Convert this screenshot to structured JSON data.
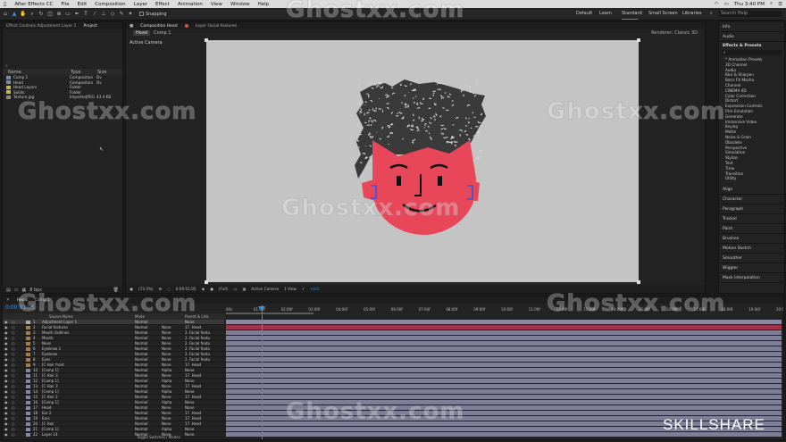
{
  "menubar": {
    "app": "After Effects CC",
    "items": [
      "File",
      "Edit",
      "Composition",
      "Layer",
      "Effect",
      "Animation",
      "View",
      "Window",
      "Help"
    ],
    "clock": "Thu 3:40 PM"
  },
  "toolbar": {
    "snapping": "Snapping",
    "workspaces": [
      "Default",
      "Learn",
      "Standard",
      "Small Screen",
      "Libraries"
    ],
    "search": "Search Help"
  },
  "project": {
    "tab_effect": "Effect Controls Adjustment Layer 1",
    "tab_project": "Project",
    "columns": [
      "Name",
      "Type",
      "Size"
    ],
    "rows": [
      {
        "name": "Comp 1",
        "type": "Composition",
        "size": "Dv"
      },
      {
        "name": "Head",
        "type": "Composition",
        "size": "Dv"
      },
      {
        "name": "Head Layers",
        "type": "Folder",
        "size": ""
      },
      {
        "name": "Solids",
        "type": "Folder",
        "size": ""
      },
      {
        "name": "Texture.jpg",
        "type": "ImporterJPEG",
        "size": "43.4 KB"
      }
    ],
    "bpc": "8 bpc"
  },
  "comp": {
    "tab_comp": "Composition Head",
    "tab_layer": "Layer Facial features",
    "sub_tabs": [
      "Head",
      "Comp 1"
    ],
    "active_camera": "Active Camera",
    "renderer_label": "Renderer:",
    "renderer": "Classic 3D",
    "footer": {
      "zoom": "(73.3%)",
      "time": "0:00:01:05",
      "res": "(Full)",
      "camera": "Active Camera",
      "view": "1 View",
      "exposure": "+0.0"
    }
  },
  "right_panel": {
    "top": [
      "Info",
      "Audio"
    ],
    "effects_title": "Effects & Presets",
    "effects": [
      "* Animation Presets",
      "3D Channel",
      "Audio",
      "Blur & Sharpen",
      "Boris FX Mocha",
      "Channel",
      "CINEMA 4D",
      "Color Correction",
      "Distort",
      "Expression Controls",
      "Film Emulation",
      "Generate",
      "Immersive Video",
      "Keying",
      "Matte",
      "Noise & Grain",
      "Obsolete",
      "Perspective",
      "Simulation",
      "Stylize",
      "Text",
      "Time",
      "Transition",
      "Utility"
    ],
    "sections": [
      "Align",
      "Character",
      "Paragraph",
      "Tracker",
      "Paint",
      "Brushes",
      "Motion Sketch",
      "Smoother",
      "Wiggler",
      "Mask Interpolation"
    ]
  },
  "timeline": {
    "tab_head": "Head",
    "tab_comp": "Comp 1",
    "timecode": "0:00:01:05",
    "col_source": "Source Name",
    "col_mode": "Mode",
    "col_parent": "Parent & Link",
    "toggle_label": "Toggle Switches / Modes",
    "ruler": [
      "00s",
      "01:00f",
      "02:00f",
      "03:00f",
      "04:00f",
      "05:00f",
      "06:00f",
      "07:00f",
      "08:00f",
      "09:00f",
      "10:00f",
      "11:00f",
      "12:00f",
      "13:00f",
      "14:00f",
      "15:00f",
      "16:00f",
      "17:00f",
      "18:00f",
      "19:00f",
      "20:00f"
    ],
    "layers": [
      {
        "num": "1",
        "name": "Adjustment Layer 1",
        "mode": "Normal",
        "trk": "",
        "parent": "None"
      },
      {
        "num": "2",
        "name": "Facial features",
        "mode": "Normal",
        "trk": "None",
        "parent": "17. Head"
      },
      {
        "num": "3",
        "name": "Mouth Outlines",
        "mode": "Normal",
        "trk": "None",
        "parent": "2. Facial featu"
      },
      {
        "num": "4",
        "name": "Mouth",
        "mode": "Normal",
        "trk": "None",
        "parent": "2. Facial featu"
      },
      {
        "num": "5",
        "name": "Nose",
        "mode": "Normal",
        "trk": "None",
        "parent": "2. Facial featu"
      },
      {
        "num": "6",
        "name": "Eyebrow 2",
        "mode": "Normal",
        "trk": "None",
        "parent": "2. Facial featu"
      },
      {
        "num": "7",
        "name": "Eyebrow",
        "mode": "Normal",
        "trk": "None",
        "parent": "2. Facial featu"
      },
      {
        "num": "8",
        "name": "Eyes",
        "mode": "Normal",
        "trk": "None",
        "parent": "2. Facial featu"
      },
      {
        "num": "9",
        "name": "[C Hair front",
        "mode": "Normal",
        "trk": "None",
        "parent": "17. Head"
      },
      {
        "num": "10",
        "name": "[Comp 1]",
        "mode": "Normal",
        "trk": "Alpha",
        "parent": "None"
      },
      {
        "num": "11",
        "name": "[C Hair 3",
        "mode": "Normal",
        "trk": "None",
        "parent": "17. Head"
      },
      {
        "num": "12",
        "name": "[Comp 1]",
        "mode": "Normal",
        "trk": "Alpha",
        "parent": "None"
      },
      {
        "num": "13",
        "name": "[C Hair 3",
        "mode": "Normal",
        "trk": "None",
        "parent": "17. Head"
      },
      {
        "num": "14",
        "name": "[Comp 1]",
        "mode": "Normal",
        "trk": "Alpha",
        "parent": "None"
      },
      {
        "num": "15",
        "name": "[C Hair 2",
        "mode": "Normal",
        "trk": "None",
        "parent": "17. Head"
      },
      {
        "num": "16",
        "name": "[Comp 1]",
        "mode": "Normal",
        "trk": "Alpha",
        "parent": "None"
      },
      {
        "num": "17",
        "name": "Head",
        "mode": "Normal",
        "trk": "None",
        "parent": "None"
      },
      {
        "num": "18",
        "name": "Ear 2",
        "mode": "Normal",
        "trk": "None",
        "parent": "17. Head"
      },
      {
        "num": "19",
        "name": "Ears",
        "mode": "Normal",
        "trk": "None",
        "parent": "17. Head"
      },
      {
        "num": "20",
        "name": "[C Hair",
        "mode": "Normal",
        "trk": "None",
        "parent": "17. Head"
      },
      {
        "num": "21",
        "name": "[Comp 1]",
        "mode": "Normal",
        "trk": "Alpha",
        "parent": "None"
      },
      {
        "num": "22",
        "name": "Layer 14",
        "mode": "Normal",
        "trk": "None",
        "parent": "None"
      }
    ]
  },
  "watermark": "Ghostxx.com",
  "brand": "SKILLSHARE",
  "colors": {
    "accent": "#3b8fe0",
    "face": "#e8475a",
    "hair": "#303030",
    "canvas": "#c4c4c4",
    "track": "#7e7f96",
    "adj": "#8a8aa5",
    "facial": "#a23448"
  }
}
